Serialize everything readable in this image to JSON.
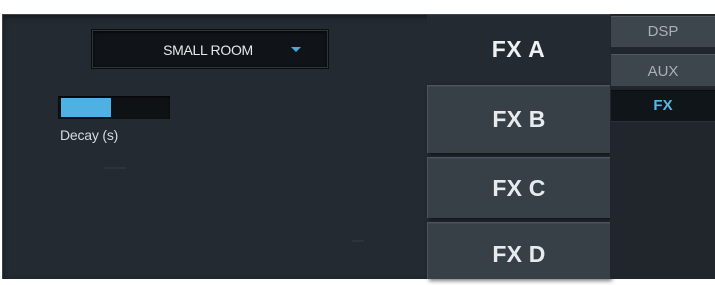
{
  "preset": {
    "selected": "SMALL ROOM"
  },
  "decay": {
    "label": "Decay (s)",
    "level_fraction": 0.47
  },
  "fx_tabs": [
    {
      "label": "FX A",
      "selected": true
    },
    {
      "label": "FX B",
      "selected": false
    },
    {
      "label": "FX C",
      "selected": false
    },
    {
      "label": "FX D",
      "selected": false
    }
  ],
  "side_tabs": [
    {
      "label": "DSP",
      "selected": false
    },
    {
      "label": "AUX",
      "selected": false
    },
    {
      "label": "FX",
      "selected": true
    }
  ],
  "colors": {
    "accent": "#4fb0e2",
    "panel_background": "#232a31",
    "tab_background": "#373f47",
    "active_side_tab_text": "#58b8ec"
  }
}
